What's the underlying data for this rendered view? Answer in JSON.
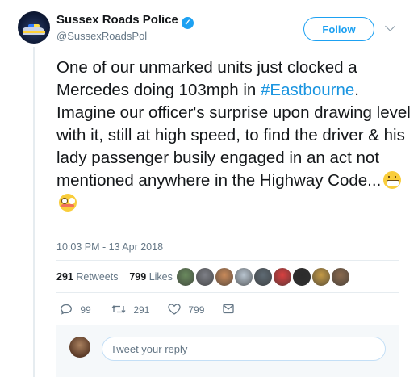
{
  "account": {
    "name": "Sussex Roads Police",
    "verified_mark": "✓",
    "handle": "@SussexRoadsPol",
    "follow_label": "Follow"
  },
  "tweet": {
    "text_part1": "One of our unmarked units just clocked a Mercedes doing 103mph in ",
    "hashtag": "#Eastbourne",
    "text_part2": ". Imagine our officer's surprise upon drawing level with it, still at high speed, to find the driver & his lady passenger busily engaged in an act not mentioned anywhere in the Highway Code...",
    "emojis": [
      "grimacing-face-icon",
      "flushed-face-icon"
    ],
    "timestamp": "10:03 PM - 13 Apr 2018"
  },
  "stats": {
    "retweets_count": "291",
    "retweets_label": "Retweets",
    "likes_count": "799",
    "likes_label": "Likes"
  },
  "likers": [
    "#6a8a5e",
    "#7d7f86",
    "#c98a5a",
    "#b8c4cf",
    "#5e6a73",
    "#d94040",
    "#2b2b2b",
    "#c49a46",
    "#8a6a4e"
  ],
  "actions": {
    "reply_count": "99",
    "retweet_count": "291",
    "like_count": "799"
  },
  "reply": {
    "placeholder": "Tweet your reply"
  },
  "colors": {
    "accent": "#1da1f2",
    "hashtag": "#1b95e0",
    "muted": "#657786"
  }
}
